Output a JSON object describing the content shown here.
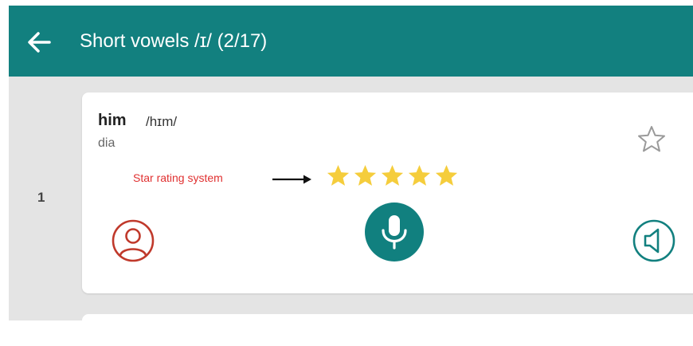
{
  "header": {
    "title": "Short vowels /ɪ/ (2/17)",
    "color": "#12807f"
  },
  "items": [
    {
      "index": "1",
      "word": "him",
      "ipa": "/hɪm/",
      "meaning": "dia",
      "rating": 5,
      "rating_max": 5,
      "favorite": false
    }
  ],
  "annotation": {
    "label": "Star rating system"
  },
  "icons": {
    "back": "arrow-left-icon",
    "favorite": "star-outline-icon",
    "rating": "star-filled-icon",
    "avatar": "user-circle-icon",
    "mic": "microphone-icon",
    "speaker": "speaker-icon"
  },
  "colors": {
    "accent": "#12807f",
    "star": "#f5cd3c",
    "annotation": "#e03030",
    "avatar": "#c0392b"
  }
}
